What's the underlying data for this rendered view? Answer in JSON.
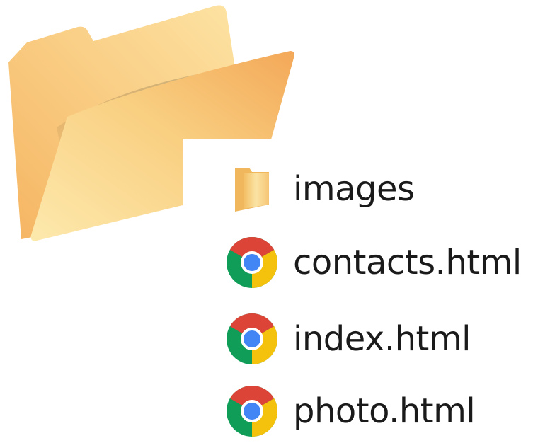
{
  "items": [
    {
      "name": "images",
      "icon": "folder-icon"
    },
    {
      "name": "contacts.html",
      "icon": "chrome-icon"
    },
    {
      "name": "index.html",
      "icon": "chrome-icon"
    },
    {
      "name": "photo.html",
      "icon": "chrome-icon"
    }
  ],
  "colors": {
    "folder_light": "#fde9a8",
    "folder_dark": "#f4ad55",
    "chrome_red": "#db4437",
    "chrome_yellow": "#f4c20d",
    "chrome_green": "#0f9d58",
    "chrome_blue": "#4285f4"
  }
}
